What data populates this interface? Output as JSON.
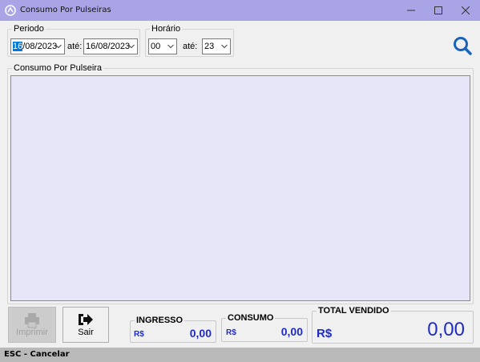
{
  "window": {
    "title": "Consumo Por Pulseiras",
    "icon": "app-logo-icon",
    "controls": [
      "minimize-icon",
      "maximize-icon",
      "close-icon"
    ]
  },
  "periodo": {
    "legend": "Periodo",
    "from_selected_part": "16",
    "from_rest": "/08/2023",
    "ate_label": "até:",
    "to_value": "16/08/2023"
  },
  "horario": {
    "legend": "Horário",
    "from_value": "00",
    "ate_label": "até:",
    "to_value": "23"
  },
  "search": {
    "icon": "search-icon",
    "color": "#1a63b7"
  },
  "grid": {
    "legend": "Consumo Por Pulseira",
    "background": "#e6e6f8"
  },
  "buttons": {
    "imprimir": {
      "label": "Imprimir",
      "icon": "printer-icon",
      "enabled": false
    },
    "sair": {
      "label": "Sair",
      "icon": "exit-arrow-icon",
      "enabled": true
    }
  },
  "ingresso": {
    "title": "INGRESSO",
    "currency": "R$",
    "value": "0,00"
  },
  "consumo": {
    "title": "CONSUMO",
    "currency": "R$",
    "value": "0,00"
  },
  "total": {
    "title": "TOTAL VENDIDO",
    "currency": "R$",
    "value": "0,00",
    "color": "#1f2bc7"
  },
  "statusbar": {
    "text": "ESC - Cancelar"
  }
}
